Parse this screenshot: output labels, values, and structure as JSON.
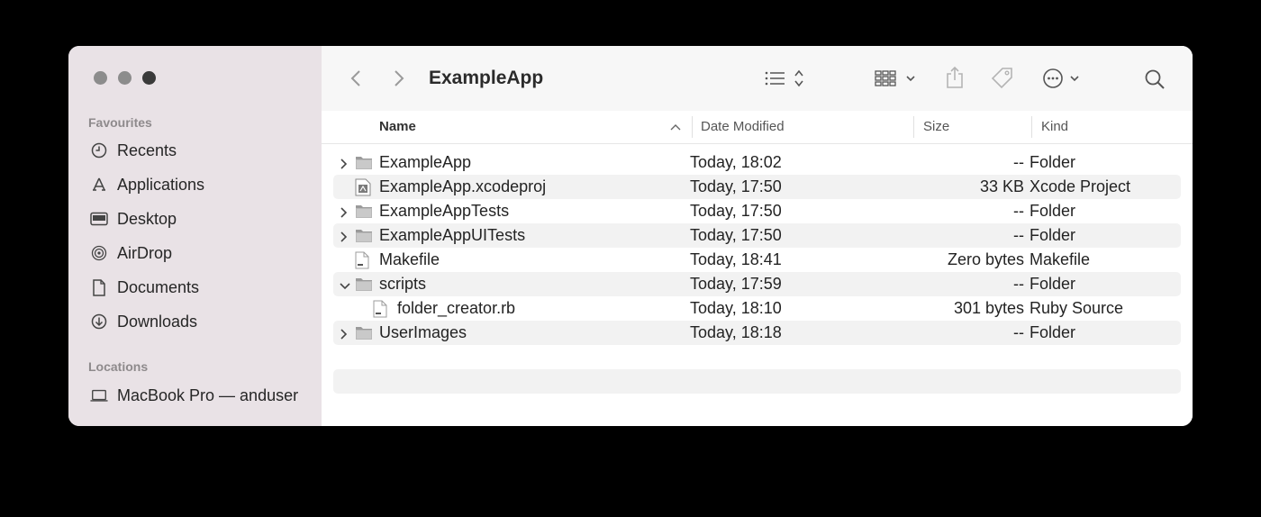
{
  "window": {
    "title": "ExampleApp"
  },
  "sidebar": {
    "favourites_label": "Favourites",
    "locations_label": "Locations",
    "favourites": [
      {
        "label": "Recents",
        "icon": "clock-icon"
      },
      {
        "label": "Applications",
        "icon": "applications-icon"
      },
      {
        "label": "Desktop",
        "icon": "desktop-icon"
      },
      {
        "label": "AirDrop",
        "icon": "airdrop-icon"
      },
      {
        "label": "Documents",
        "icon": "document-icon"
      },
      {
        "label": "Downloads",
        "icon": "download-icon"
      }
    ],
    "locations": [
      {
        "label": "MacBook Pro — anduser",
        "icon": "laptop-icon"
      }
    ]
  },
  "columns": {
    "name": "Name",
    "date": "Date Modified",
    "size": "Size",
    "kind": "Kind"
  },
  "files": [
    {
      "name": "ExampleApp",
      "date": "Today, 18:02",
      "size": "--",
      "kind": "Folder",
      "type": "folder",
      "disclosure": "collapsed"
    },
    {
      "name": "ExampleApp.xcodeproj",
      "date": "Today, 17:50",
      "size": "33 KB",
      "kind": "Xcode Project",
      "type": "xcodeproj",
      "disclosure": "none"
    },
    {
      "name": "ExampleAppTests",
      "date": "Today, 17:50",
      "size": "--",
      "kind": "Folder",
      "type": "folder",
      "disclosure": "collapsed"
    },
    {
      "name": "ExampleAppUITests",
      "date": "Today, 17:50",
      "size": "--",
      "kind": "Folder",
      "type": "folder",
      "disclosure": "collapsed"
    },
    {
      "name": "Makefile",
      "date": "Today, 18:41",
      "size": "Zero bytes",
      "kind": "Makefile",
      "type": "file",
      "disclosure": "none"
    },
    {
      "name": "scripts",
      "date": "Today, 17:59",
      "size": "--",
      "kind": "Folder",
      "type": "folder",
      "disclosure": "expanded"
    },
    {
      "name": "folder_creator.rb",
      "date": "Today, 18:10",
      "size": "301 bytes",
      "kind": "Ruby Source",
      "type": "file",
      "disclosure": "none",
      "child": true
    },
    {
      "name": "UserImages",
      "date": "Today, 18:18",
      "size": "--",
      "kind": "Folder",
      "type": "folder",
      "disclosure": "collapsed"
    }
  ]
}
